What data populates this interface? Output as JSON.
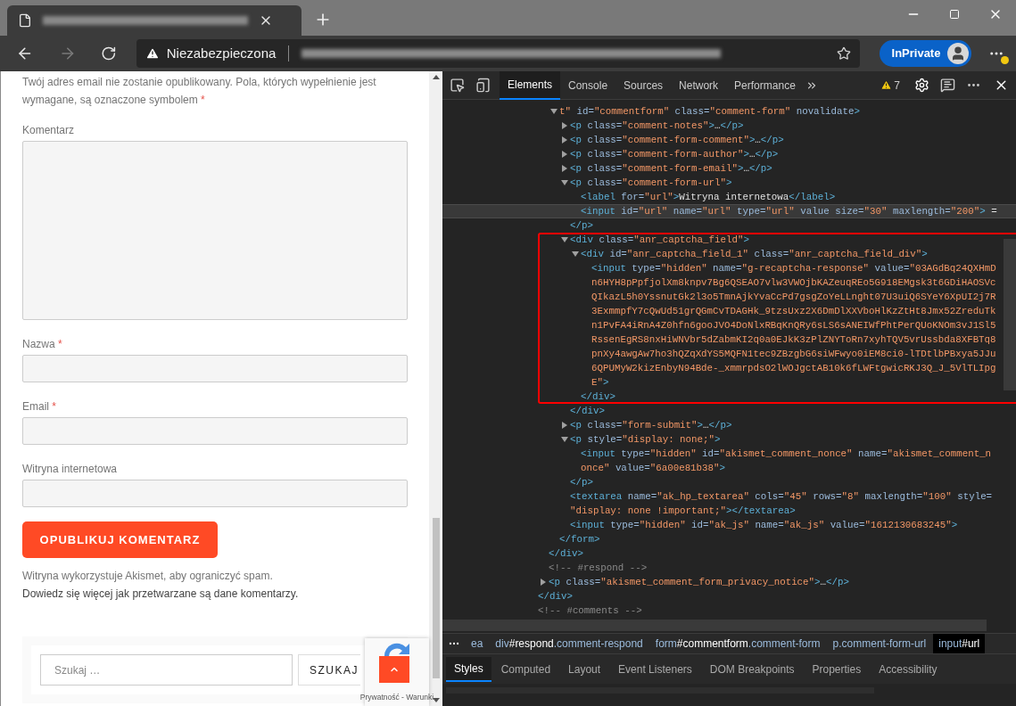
{
  "browser": {
    "address_bar": {
      "security_label": "Niezabezpieczona"
    },
    "profile_button": {
      "label": "InPrivate"
    }
  },
  "page": {
    "notes": {
      "text": "Twój adres email nie zostanie opublikowany. Pola, których wypełnienie jest wymagane, są oznaczone symbolem",
      "required_mark": "*"
    },
    "fields": [
      {
        "label": "Komentarz",
        "kind": "textarea"
      },
      {
        "label": "Nazwa",
        "required_mark": "*",
        "kind": "input"
      },
      {
        "label": "Email",
        "required_mark": "*",
        "kind": "input"
      },
      {
        "label": "Witryna internetowa",
        "kind": "input"
      }
    ],
    "submit_button": "OPUBLIKUJ KOMENTARZ",
    "privacy": {
      "text": "Witryna wykorzystuje Akismet, aby ograniczyć spam.",
      "link": "Dowiedz się więcej jak przetwarzane są dane komentarzy."
    },
    "search": {
      "placeholder": "Szukaj …",
      "button": "SZUKAJ"
    },
    "recaptcha_badge": {
      "links": "Prywatność - Warunki"
    }
  },
  "devtools": {
    "tabs": [
      {
        "label": "Elements",
        "selected": true
      },
      {
        "label": "Console",
        "selected": false
      },
      {
        "label": "Sources",
        "selected": false
      },
      {
        "label": "Network",
        "selected": false
      },
      {
        "label": "Performance",
        "selected": false
      }
    ],
    "warnings": "7",
    "dom_tree": [
      {
        "kind": "fragment",
        "children": [
          {
            "kind": "fragment",
            "children": [
              {
                "kind": "container",
                "expanded": true,
                "selected": false,
                "lines": [
                  [
                    {
                      "kind": "value",
                      "text": "t\""
                    },
                    {
                      "kind": "attr",
                      "text": " id="
                    },
                    {
                      "kind": "value",
                      "text": "\"commentform\""
                    },
                    {
                      "kind": "attr",
                      "text": " class="
                    },
                    {
                      "kind": "value",
                      "text": "\"comment-form\""
                    },
                    {
                      "kind": "attr",
                      "text": " novalidate"
                    },
                    {
                      "kind": "tag",
                      "text": ">"
                    }
                  ]
                ],
                "children": [
                  {
                    "kind": "container",
                    "expanded": false,
                    "selected": false,
                    "lines": [
                      [
                        {
                          "kind": "tag",
                          "text": "<p"
                        },
                        {
                          "kind": "attr",
                          "text": " class="
                        },
                        {
                          "kind": "value",
                          "text": "\"comment-notes\""
                        },
                        {
                          "kind": "tag",
                          "text": ">"
                        },
                        {
                          "kind": "text",
                          "text": "…"
                        },
                        {
                          "kind": "tag",
                          "text": "</p>"
                        }
                      ]
                    ]
                  },
                  {
                    "kind": "container",
                    "expanded": false,
                    "selected": false,
                    "lines": [
                      [
                        {
                          "kind": "tag",
                          "text": "<p"
                        },
                        {
                          "kind": "attr",
                          "text": " class="
                        },
                        {
                          "kind": "value",
                          "text": "\"comment-form-comment\""
                        },
                        {
                          "kind": "tag",
                          "text": ">"
                        },
                        {
                          "kind": "text",
                          "text": "…"
                        },
                        {
                          "kind": "tag",
                          "text": "</p>"
                        }
                      ]
                    ]
                  },
                  {
                    "kind": "container",
                    "expanded": false,
                    "selected": false,
                    "lines": [
                      [
                        {
                          "kind": "tag",
                          "text": "<p"
                        },
                        {
                          "kind": "attr",
                          "text": " class="
                        },
                        {
                          "kind": "value",
                          "text": "\"comment-form-author\""
                        },
                        {
                          "kind": "tag",
                          "text": ">"
                        },
                        {
                          "kind": "text",
                          "text": "…"
                        },
                        {
                          "kind": "tag",
                          "text": "</p>"
                        }
                      ]
                    ]
                  },
                  {
                    "kind": "container",
                    "expanded": false,
                    "selected": false,
                    "lines": [
                      [
                        {
                          "kind": "tag",
                          "text": "<p"
                        },
                        {
                          "kind": "attr",
                          "text": " class="
                        },
                        {
                          "kind": "value",
                          "text": "\"comment-form-email\""
                        },
                        {
                          "kind": "tag",
                          "text": ">"
                        },
                        {
                          "kind": "text",
                          "text": "…"
                        },
                        {
                          "kind": "tag",
                          "text": "</p>"
                        }
                      ]
                    ]
                  },
                  {
                    "kind": "container",
                    "expanded": true,
                    "selected": false,
                    "lines": [
                      [
                        {
                          "kind": "tag",
                          "text": "<p"
                        },
                        {
                          "kind": "attr",
                          "text": " class="
                        },
                        {
                          "kind": "value",
                          "text": "\"comment-form-url\""
                        },
                        {
                          "kind": "tag",
                          "text": ">"
                        }
                      ]
                    ],
                    "children": [
                      {
                        "kind": "leaf",
                        "selected": false,
                        "lines": [
                          [
                            {
                              "kind": "tag",
                              "text": "<label"
                            },
                            {
                              "kind": "attr",
                              "text": " for="
                            },
                            {
                              "kind": "value",
                              "text": "\"url\""
                            },
                            {
                              "kind": "tag",
                              "text": ">"
                            },
                            {
                              "kind": "text",
                              "text": "Witryna internetowa"
                            },
                            {
                              "kind": "tag",
                              "text": "</label>"
                            }
                          ]
                        ]
                      },
                      {
                        "kind": "leaf",
                        "selected": true,
                        "lines": [
                          [
                            {
                              "kind": "tag",
                              "text": "<input"
                            },
                            {
                              "kind": "attr",
                              "text": " id="
                            },
                            {
                              "kind": "value",
                              "text": "\"url\""
                            },
                            {
                              "kind": "attr",
                              "text": " name="
                            },
                            {
                              "kind": "value",
                              "text": "\"url\""
                            },
                            {
                              "kind": "attr",
                              "text": " type="
                            },
                            {
                              "kind": "value",
                              "text": "\"url\""
                            },
                            {
                              "kind": "attr",
                              "text": " value size="
                            },
                            {
                              "kind": "value",
                              "text": "\"30\""
                            },
                            {
                              "kind": "attr",
                              "text": " maxlength="
                            },
                            {
                              "kind": "value",
                              "text": "\"200\""
                            },
                            {
                              "kind": "tag",
                              "text": ">"
                            },
                            {
                              "kind": "text",
                              "text": " ="
                            }
                          ]
                        ]
                      }
                    ],
                    "close": [
                      {
                        "kind": "tag",
                        "text": "</p>"
                      }
                    ]
                  },
                  {
                    "kind": "container",
                    "expanded": true,
                    "selected": false,
                    "lines": [
                      [
                        {
                          "kind": "tag",
                          "text": "<div"
                        },
                        {
                          "kind": "attr",
                          "text": " class="
                        },
                        {
                          "kind": "value",
                          "text": "\"anr_captcha_field\""
                        },
                        {
                          "kind": "tag",
                          "text": ">"
                        }
                      ]
                    ],
                    "children": [
                      {
                        "kind": "container",
                        "expanded": true,
                        "selected": false,
                        "lines": [
                          [
                            {
                              "kind": "tag",
                              "text": "<div"
                            },
                            {
                              "kind": "attr",
                              "text": " id="
                            },
                            {
                              "kind": "value",
                              "text": "\"anr_captcha_field_1\""
                            },
                            {
                              "kind": "attr",
                              "text": " class="
                            },
                            {
                              "kind": "value",
                              "text": "\"anr_captcha_field_div\""
                            },
                            {
                              "kind": "tag",
                              "text": ">"
                            }
                          ]
                        ],
                        "children": [
                          {
                            "kind": "leaf",
                            "selected": false,
                            "lines": [
                              [
                                {
                                  "kind": "tag",
                                  "text": "<input"
                                },
                                {
                                  "kind": "attr",
                                  "text": " type="
                                },
                                {
                                  "kind": "value",
                                  "text": "\"hidden\""
                                },
                                {
                                  "kind": "attr",
                                  "text": " name="
                                },
                                {
                                  "kind": "value",
                                  "text": "\"g-recaptcha-response\""
                                },
                                {
                                  "kind": "attr",
                                  "text": " value="
                                },
                                {
                                  "kind": "value",
                                  "text": "\"03AGdBq24QXHmD"
                                }
                              ],
                              [
                                {
                                  "kind": "value",
                                  "text": "n6HYH8pPpfjolXm8knpv7Bg6QSEAO7vlw3VWOjbKAZeuqREo5G918EMgsk3t6GDiHAOSVc"
                                }
                              ],
                              [
                                {
                                  "kind": "value",
                                  "text": "QIkazL5h0YssnutGk2l3o5TmnAjkYvaCcPd7gsgZoYeLLnght07U3uiQ6SYeY6XpUI2j7R"
                                }
                              ],
                              [
                                {
                                  "kind": "value",
                                  "text": "3ExmmpfY7cQwUd51grQGmCvTDAGHk_9tzsUxz2X6DmDlXXVboHlKzZtHt8Jmx52ZreduTk"
                                }
                              ],
                              [
                                {
                                  "kind": "value",
                                  "text": "n1PvFA4iRnA4Z0hfn6gooJVO4DoNlxRBqKnQRy6sLS6sANEIWfPhtPerQUoKNOm3vJ1Sl5"
                                }
                              ],
                              [
                                {
                                  "kind": "value",
                                  "text": "RssenEgRS8nxHiWNVbr5dZabmKI2q0a0EJkK3zPlZNYToRn7xyhTQV5vrUssbda8XFBTq8"
                                }
                              ],
                              [
                                {
                                  "kind": "value",
                                  "text": "pnXy4awgAw7ho3hQZqXdYS5MQFN1tec9ZBzgbG6siWFwyo0iEM8ci0-lTDtlbPBxya5JJu"
                                }
                              ],
                              [
                                {
                                  "kind": "value",
                                  "text": "6QPUMyW2kizEnbyN94Bde-_xmmrpdsO2lWOJgctAB10k6fLWFtgwicRKJ3Q_J_5VlTLIpg"
                                }
                              ],
                              [
                                {
                                  "kind": "value",
                                  "text": "E\""
                                },
                                {
                                  "kind": "tag",
                                  "text": ">"
                                }
                              ]
                            ]
                          }
                        ],
                        "close": [
                          {
                            "kind": "tag",
                            "text": "</div>"
                          }
                        ]
                      }
                    ],
                    "close": [
                      {
                        "kind": "tag",
                        "text": "</div>"
                      }
                    ]
                  },
                  {
                    "kind": "container",
                    "expanded": false,
                    "selected": false,
                    "lines": [
                      [
                        {
                          "kind": "tag",
                          "text": "<p"
                        },
                        {
                          "kind": "attr",
                          "text": " class="
                        },
                        {
                          "kind": "value",
                          "text": "\"form-submit\""
                        },
                        {
                          "kind": "tag",
                          "text": ">"
                        },
                        {
                          "kind": "text",
                          "text": "…"
                        },
                        {
                          "kind": "tag",
                          "text": "</p>"
                        }
                      ]
                    ]
                  },
                  {
                    "kind": "container",
                    "expanded": true,
                    "selected": false,
                    "lines": [
                      [
                        {
                          "kind": "tag",
                          "text": "<p"
                        },
                        {
                          "kind": "attr",
                          "text": " style="
                        },
                        {
                          "kind": "value",
                          "text": "\"display: none;\""
                        },
                        {
                          "kind": "tag",
                          "text": ">"
                        }
                      ]
                    ],
                    "children": [
                      {
                        "kind": "leaf",
                        "selected": false,
                        "lines": [
                          [
                            {
                              "kind": "tag",
                              "text": "<input"
                            },
                            {
                              "kind": "attr",
                              "text": " type="
                            },
                            {
                              "kind": "value",
                              "text": "\"hidden\""
                            },
                            {
                              "kind": "attr",
                              "text": " id="
                            },
                            {
                              "kind": "value",
                              "text": "\"akismet_comment_nonce\""
                            },
                            {
                              "kind": "attr",
                              "text": " name="
                            },
                            {
                              "kind": "value",
                              "text": "\"akismet_comment_n"
                            }
                          ],
                          [
                            {
                              "kind": "value",
                              "text": "once\""
                            },
                            {
                              "kind": "attr",
                              "text": " value="
                            },
                            {
                              "kind": "value",
                              "text": "\"6a00e81b38\""
                            },
                            {
                              "kind": "tag",
                              "text": ">"
                            }
                          ]
                        ]
                      }
                    ],
                    "close": [
                      {
                        "kind": "tag",
                        "text": "</p>"
                      }
                    ]
                  },
                  {
                    "kind": "leaf",
                    "selected": false,
                    "lines": [
                      [
                        {
                          "kind": "tag",
                          "text": "<textarea"
                        },
                        {
                          "kind": "attr",
                          "text": " name="
                        },
                        {
                          "kind": "value",
                          "text": "\"ak_hp_textarea\""
                        },
                        {
                          "kind": "attr",
                          "text": " cols="
                        },
                        {
                          "kind": "value",
                          "text": "\"45\""
                        },
                        {
                          "kind": "attr",
                          "text": " rows="
                        },
                        {
                          "kind": "value",
                          "text": "\"8\""
                        },
                        {
                          "kind": "attr",
                          "text": " maxlength="
                        },
                        {
                          "kind": "value",
                          "text": "\"100\""
                        },
                        {
                          "kind": "attr",
                          "text": " style="
                        }
                      ],
                      [
                        {
                          "kind": "value",
                          "text": "\"display: none !important;\""
                        },
                        {
                          "kind": "tag",
                          "text": "></textarea>"
                        }
                      ]
                    ]
                  },
                  {
                    "kind": "leaf",
                    "selected": false,
                    "lines": [
                      [
                        {
                          "kind": "tag",
                          "text": "<input"
                        },
                        {
                          "kind": "attr",
                          "text": " type="
                        },
                        {
                          "kind": "value",
                          "text": "\"hidden\""
                        },
                        {
                          "kind": "attr",
                          "text": " id="
                        },
                        {
                          "kind": "value",
                          "text": "\"ak_js\""
                        },
                        {
                          "kind": "attr",
                          "text": " name="
                        },
                        {
                          "kind": "value",
                          "text": "\"ak_js\""
                        },
                        {
                          "kind": "attr",
                          "text": " value="
                        },
                        {
                          "kind": "value",
                          "text": "\"1612130683245\""
                        },
                        {
                          "kind": "tag",
                          "text": ">"
                        }
                      ]
                    ]
                  }
                ],
                "close": [
                  {
                    "kind": "tag",
                    "text": "</form>"
                  }
                ]
              }
            ],
            "close": [
              {
                "kind": "tag",
                "text": "</div>"
              }
            ]
          },
          {
            "kind": "leaf",
            "selected": false,
            "lines": [
              [
                {
                  "kind": "comment",
                  "text": "<!-- #respond -->"
                }
              ]
            ]
          },
          {
            "kind": "container",
            "expanded": false,
            "selected": false,
            "lines": [
              [
                {
                  "kind": "tag",
                  "text": "<p"
                },
                {
                  "kind": "attr",
                  "text": " class="
                },
                {
                  "kind": "value",
                  "text": "\"akismet_comment_form_privacy_notice\""
                },
                {
                  "kind": "tag",
                  "text": ">"
                },
                {
                  "kind": "text",
                  "text": "…"
                },
                {
                  "kind": "tag",
                  "text": "</p>"
                }
              ]
            ]
          }
        ],
        "close": [
          {
            "kind": "tag",
            "text": "</div>"
          }
        ]
      },
      {
        "kind": "leaf",
        "selected": false,
        "lines": [
          [
            {
              "kind": "comment",
              "text": "<!-- #comments -->"
            }
          ]
        ]
      }
    ],
    "breadcrumbs": [
      {
        "element": "ea",
        "selected": false
      },
      {
        "element": "div",
        "id": "#respond",
        "classes": ".comment-respond",
        "selected": false
      },
      {
        "element": "form",
        "id": "#commentform",
        "classes": ".comment-form",
        "selected": false
      },
      {
        "element": "p",
        "classes": ".comment-form-url",
        "selected": false
      },
      {
        "element": "input",
        "id": "#url",
        "selected": true
      }
    ],
    "panel_tabs": [
      {
        "label": "Styles",
        "selected": true
      },
      {
        "label": "Computed",
        "selected": false
      },
      {
        "label": "Layout",
        "selected": false
      },
      {
        "label": "Event Listeners",
        "selected": false
      },
      {
        "label": "DOM Breakpoints",
        "selected": false
      },
      {
        "label": "Properties",
        "selected": false
      },
      {
        "label": "Accessibility",
        "selected": false
      }
    ]
  }
}
